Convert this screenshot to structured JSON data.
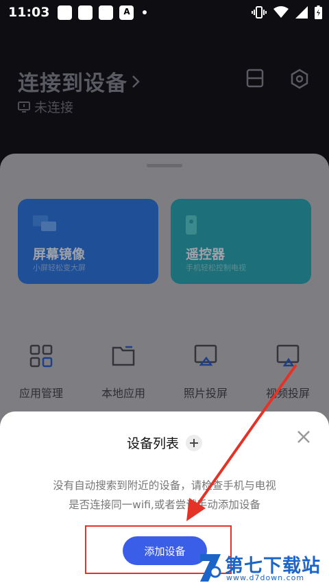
{
  "status_bar": {
    "time": "11:03"
  },
  "header": {
    "title": "连接到设备",
    "connection_status": "未连接"
  },
  "features": [
    {
      "title": "屏幕镜像",
      "subtitle": "小屏轻松变大屏",
      "icon": "screen-mirror-icon",
      "color": "#1f4f97"
    },
    {
      "title": "遥控器",
      "subtitle": "手机轻松控制电视",
      "icon": "remote-control-icon",
      "color": "#1d6f7a"
    }
  ],
  "apps": [
    {
      "label": "应用管理",
      "icon": "app-grid-icon"
    },
    {
      "label": "本地应用",
      "icon": "folder-icon"
    },
    {
      "label": "照片投屏",
      "icon": "photo-cast-icon"
    },
    {
      "label": "视频投屏",
      "icon": "video-cast-icon"
    }
  ],
  "sheet": {
    "title": "设备列表",
    "message_line1": "没有自动搜索到附近的设备，请检查手机与电视",
    "message_line2": "是否连接同一wifi,或者尝试手动添加设备",
    "add_button": "添加设备"
  },
  "watermark": {
    "title": "第七下载站",
    "url": "www.d7down.com"
  },
  "colors": {
    "accent": "#3b5ee8",
    "annotation": "#e53226",
    "watermark": "#1b64c8"
  }
}
